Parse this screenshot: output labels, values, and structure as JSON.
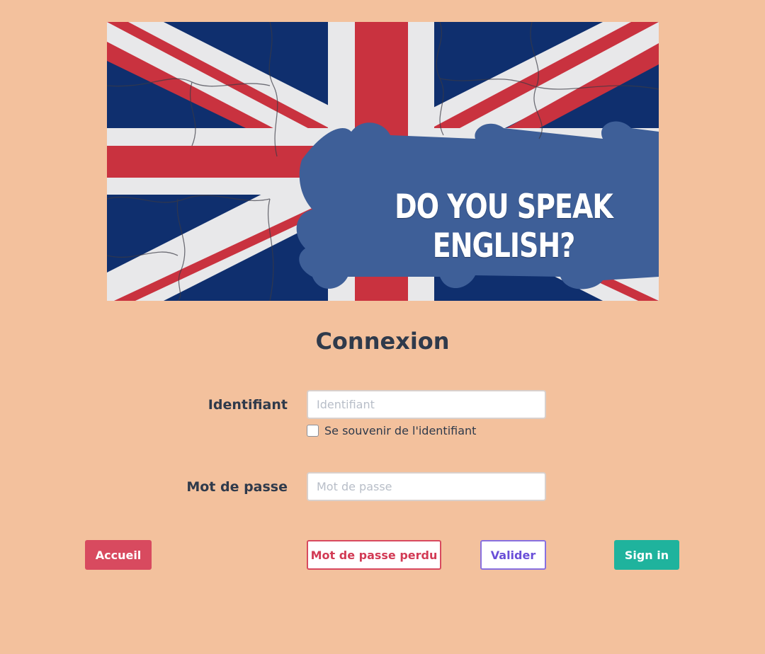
{
  "banner": {
    "text": "DO YOU SPEAK ENGLISH?",
    "image_description_icon": "union-jack-puzzle-image"
  },
  "page_title": "Connexion",
  "form": {
    "identifiant_label": "Identifiant",
    "identifiant_placeholder": "Identifiant",
    "identifiant_value": "",
    "remember_label": "Se souvenir de l'identifiant",
    "remember_checked": false,
    "password_label": "Mot de passe",
    "password_placeholder": "Mot de passe",
    "password_value": ""
  },
  "buttons": {
    "home": "Accueil",
    "lost_password": "Mot de passe perdu",
    "validate": "Valider",
    "sign_in": "Sign in"
  },
  "colors": {
    "background": "#f3c19d",
    "home_button": "#d84a5f",
    "lost_password_border": "#d84a5f",
    "validate_border": "#8870e0",
    "sign_in_button": "#1fb39d",
    "text": "#2f3a4b"
  }
}
